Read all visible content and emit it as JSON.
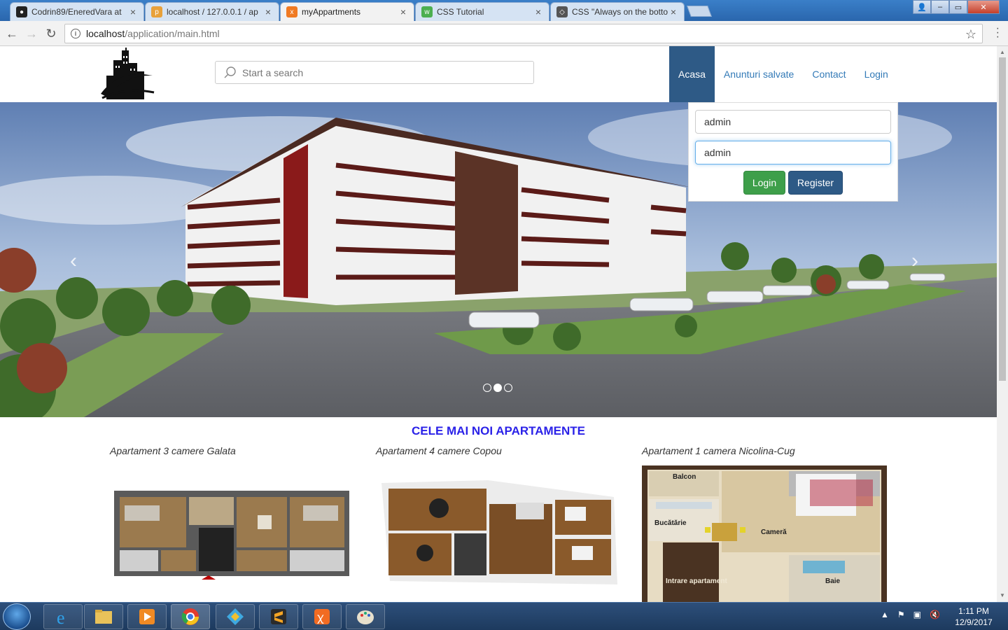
{
  "browser": {
    "tabs": [
      {
        "title": "Codrin89/EneredVara at",
        "favicon": "github-icon",
        "active": false
      },
      {
        "title": "localhost / 127.0.0.1 / ap",
        "favicon": "phpmyadmin-icon",
        "active": false
      },
      {
        "title": "myAppartments",
        "favicon": "xampp-icon",
        "active": true
      },
      {
        "title": "CSS Tutorial",
        "favicon": "w3schools-icon",
        "active": false
      },
      {
        "title": "CSS \"Always on the botto",
        "favicon": "stackoverflow-icon",
        "active": false
      }
    ],
    "url_host": "localhost",
    "url_path": "/application/main.html"
  },
  "header": {
    "search_placeholder": "Start a search",
    "nav": [
      "Acasa",
      "Anunturi salvate",
      "Contact",
      "Login"
    ],
    "active_nav": "Acasa"
  },
  "login": {
    "username": "admin",
    "password": "admin",
    "login_label": "Login",
    "register_label": "Register"
  },
  "carousel": {
    "slides": 3,
    "active_slide": 2
  },
  "listings": {
    "title": "CELE MAI NOI APARTAMENTE",
    "items": [
      {
        "caption": "Apartament 3 camere Galata"
      },
      {
        "caption": "Apartament 4 camere Copou"
      },
      {
        "caption": "Apartament 1 camera Nicolina-Cug"
      }
    ],
    "floorplan_labels": [
      "Balcon",
      "Bucătărie",
      "Cameră",
      "Baie",
      "Intrare apartament"
    ]
  },
  "taskbar": {
    "time": "1:11 PM",
    "date": "12/9/2017"
  },
  "colors": {
    "nav_active": "#2e5a86",
    "link": "#337ab7",
    "section_title": "#2b22e8",
    "login_button": "#3e9f4a",
    "register_button": "#2e5a86"
  }
}
